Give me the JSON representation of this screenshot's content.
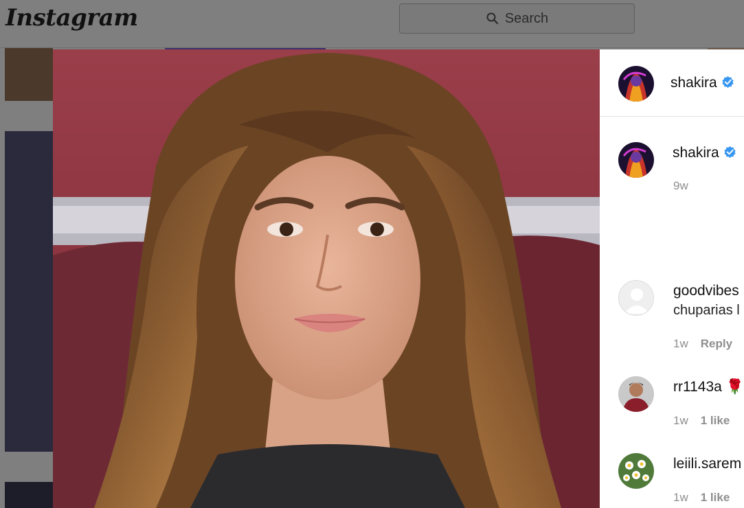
{
  "app": {
    "logo_text": "Instagram"
  },
  "search": {
    "placeholder": "Search"
  },
  "post": {
    "author": "shakira",
    "author_verified": true
  },
  "caption": {
    "author": "shakira",
    "time": "9w"
  },
  "comments": [
    {
      "username": "goodvibes",
      "text": "chuparias l",
      "time": "1w",
      "action": "Reply",
      "emoji": ""
    },
    {
      "username": "rr1143a",
      "text": "",
      "time": "1w",
      "action": "1 like",
      "emoji": "🌹"
    },
    {
      "username": "leiili.sarem",
      "text": "",
      "time": "1w",
      "action": "1 like",
      "emoji": ""
    }
  ],
  "colors": {
    "verified_blue": "#3897f0",
    "overlay": "#7f7f7f"
  }
}
